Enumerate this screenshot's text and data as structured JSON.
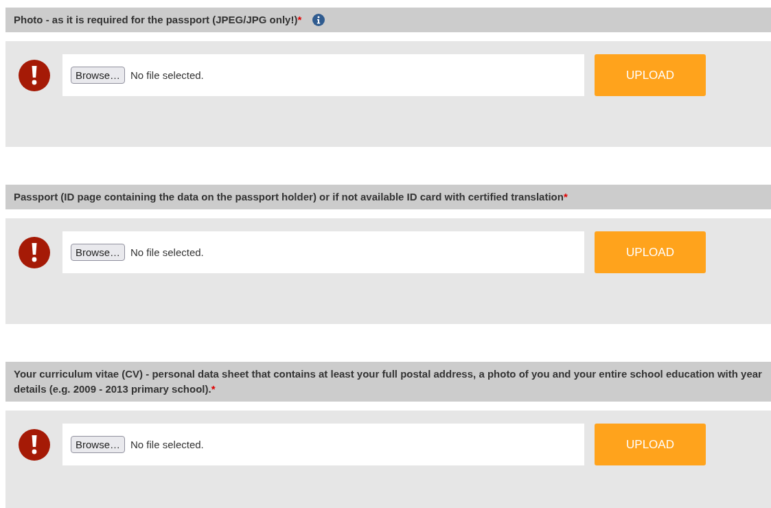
{
  "sections": [
    {
      "heading": "Photo - as it is required for the passport (JPEG/JPG only!)",
      "required_mark": "*",
      "info": true,
      "error": true,
      "browse_label": "Browse…",
      "file_text": "No file selected.",
      "upload_label": "UPLOAD"
    },
    {
      "heading": "Passport (ID page containing the data on the passport holder) or if not available ID card with certified translation",
      "required_mark": "*",
      "info": false,
      "error": true,
      "browse_label": "Browse…",
      "file_text": "No file selected.",
      "upload_label": "UPLOAD"
    },
    {
      "heading": "Your curriculum vitae (CV) - personal data sheet that contains at least your full postal address, a photo of you and your entire school education with year details (e.g. 2009 - 2013 primary school).",
      "required_mark": "*",
      "info": false,
      "error": true,
      "browse_label": "Browse…",
      "file_text": "No file selected.",
      "upload_label": "UPLOAD"
    }
  ]
}
